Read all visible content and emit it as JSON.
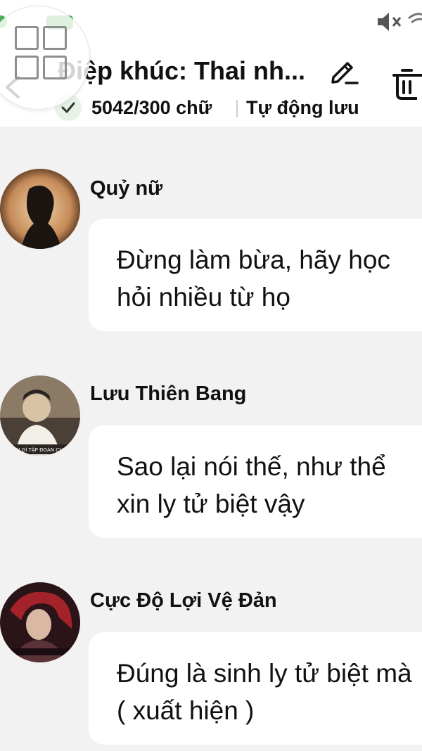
{
  "colors": {
    "background": "#f2f2f2",
    "bubble": "#ffffff",
    "accent_green": "#4caf50"
  },
  "header": {
    "title": "Điệp khúc: Thai nh...",
    "word_count": "5042/300 chữ",
    "autosave_label": "Tự động lưu"
  },
  "icons": {
    "back": "chevron-left-icon",
    "edit": "pencil-icon",
    "delete": "trash-icon",
    "saved": "check-icon",
    "grid": "grid-icon",
    "mute": "volume-mute-icon",
    "wifi": "wifi-icon"
  },
  "messages": [
    {
      "sender": "Quỷ nữ",
      "text": "Đừng làm bừa, hãy học hỏi nhiều từ họ"
    },
    {
      "sender": "Lưu Thiên Bang",
      "text": "Sao lại nói thế, như thể xin ly tử biệt vậy",
      "avatar_caption": "CÁI GÌ TẬP ĐOÀN CHỨ?"
    },
    {
      "sender": "Cực Độ Lợi Vệ Đản",
      "text": "Đúng là sinh ly tử biệt mà ( xuất hiện )"
    }
  ]
}
